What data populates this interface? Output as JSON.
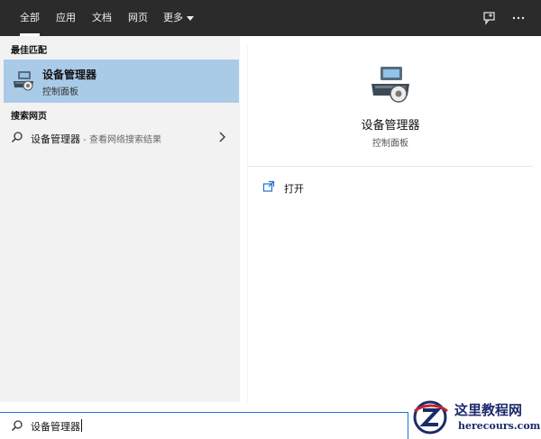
{
  "tabs": [
    {
      "label": "全部",
      "active": true
    },
    {
      "label": "应用"
    },
    {
      "label": "文档"
    },
    {
      "label": "网页"
    },
    {
      "label": "更多"
    }
  ],
  "topbar_icons": [
    "feedback-icon",
    "more-options-icon"
  ],
  "left": {
    "best_match_heading": "最佳匹配",
    "best_match": {
      "title": "设备管理器",
      "subtitle": "控制面板",
      "icon": "device-manager-icon"
    },
    "web_heading": "搜索网页",
    "web_result": {
      "query": "设备管理器",
      "hint": " - 查看网络搜索结果"
    }
  },
  "right": {
    "title": "设备管理器",
    "subtitle": "控制面板",
    "actions": [
      {
        "label": "打开",
        "icon": "open-icon"
      }
    ]
  },
  "search": {
    "value": "设备管理器"
  },
  "watermark": {
    "title": "这里教程网",
    "url": "herecours.com"
  },
  "colors": {
    "topbar": "#2b2b2b",
    "selected": "#a9cbe8",
    "pane": "#f2f2f2",
    "accent": "#1f6fd6"
  }
}
